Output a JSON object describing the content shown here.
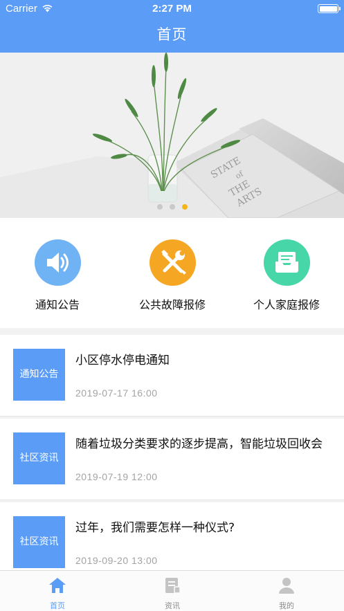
{
  "status_bar": {
    "carrier": "Carrier",
    "time": "2:27 PM"
  },
  "header": {
    "title": "首页"
  },
  "banner": {
    "slide_count": 3,
    "active_slide": 3,
    "active_dot_color": "#f5b417",
    "book_text": [
      "STATE",
      "of",
      "THE",
      "ARTS"
    ]
  },
  "quick_menu": [
    {
      "label": "通知公告",
      "icon": "speaker-icon",
      "color": "#6fb3f5"
    },
    {
      "label": "公共故障报修",
      "icon": "tools-icon",
      "color": "#f5a623"
    },
    {
      "label": "个人家庭报修",
      "icon": "inbox-icon",
      "color": "#47d6a8"
    }
  ],
  "news": [
    {
      "tag": "通知公告",
      "title": "小区停水停电通知",
      "date": "2019-07-17 16:00"
    },
    {
      "tag": "社区资讯",
      "title": "随着垃圾分类要求的逐步提高，智能垃圾回收会",
      "date": "2019-07-19 12:00"
    },
    {
      "tag": "社区资讯",
      "title": "过年，我们需要怎样一种仪式?",
      "date": "2019-09-20 13:00"
    }
  ],
  "tabbar": [
    {
      "label": "首页",
      "icon": "home-icon",
      "active": true
    },
    {
      "label": "资讯",
      "icon": "news-icon",
      "active": false
    },
    {
      "label": "我的",
      "icon": "user-icon",
      "active": false
    }
  ],
  "colors": {
    "primary": "#5b9cf6",
    "date_gray": "#a3a3a3"
  }
}
